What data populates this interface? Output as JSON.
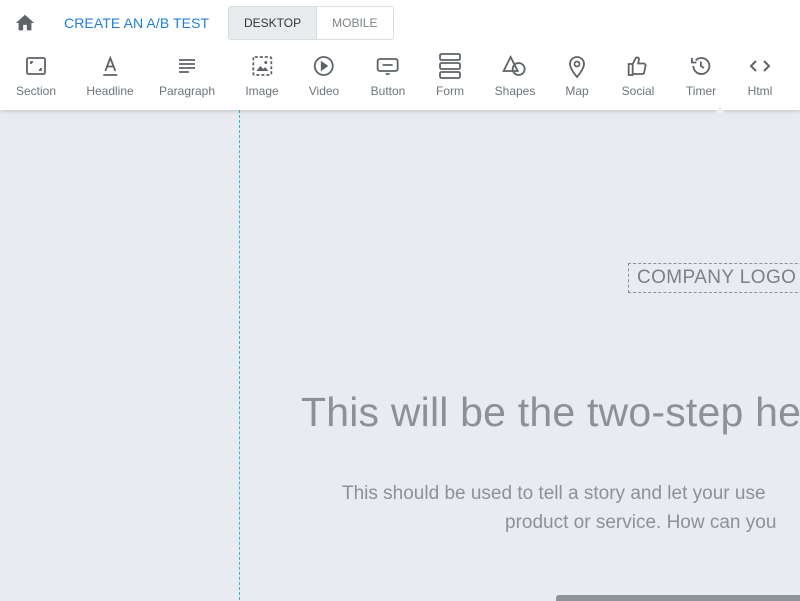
{
  "header": {
    "home_icon": "home-icon",
    "ab_test_label": "CREATE AN A/B TEST",
    "view_modes": [
      {
        "label": "DESKTOP",
        "active": true
      },
      {
        "label": "MOBILE",
        "active": false
      }
    ]
  },
  "toolbar": {
    "items": [
      {
        "label": "Section",
        "icon": "section-icon"
      },
      {
        "label": "Headline",
        "icon": "headline-icon"
      },
      {
        "label": "Paragraph",
        "icon": "paragraph-icon"
      },
      {
        "label": "Image",
        "icon": "image-icon"
      },
      {
        "label": "Video",
        "icon": "video-icon"
      },
      {
        "label": "Button",
        "icon": "button-icon"
      },
      {
        "label": "Form",
        "icon": "form-icon"
      },
      {
        "label": "Shapes",
        "icon": "shapes-icon"
      },
      {
        "label": "Map",
        "icon": "map-icon"
      },
      {
        "label": "Social",
        "icon": "social-icon"
      },
      {
        "label": "Timer",
        "icon": "timer-icon"
      },
      {
        "label": "Html",
        "icon": "html-icon"
      }
    ]
  },
  "canvas": {
    "logo_placeholder": "COMPANY LOGO",
    "headline": "This will be the two-step hea",
    "subtext_line1": "This should be used to tell a story and let your use",
    "subtext_line2": "product or service. How can you"
  },
  "colors": {
    "accent": "#1d7fe0",
    "guide": "#2bbbd8",
    "canvas_bg": "#e8ebef"
  }
}
